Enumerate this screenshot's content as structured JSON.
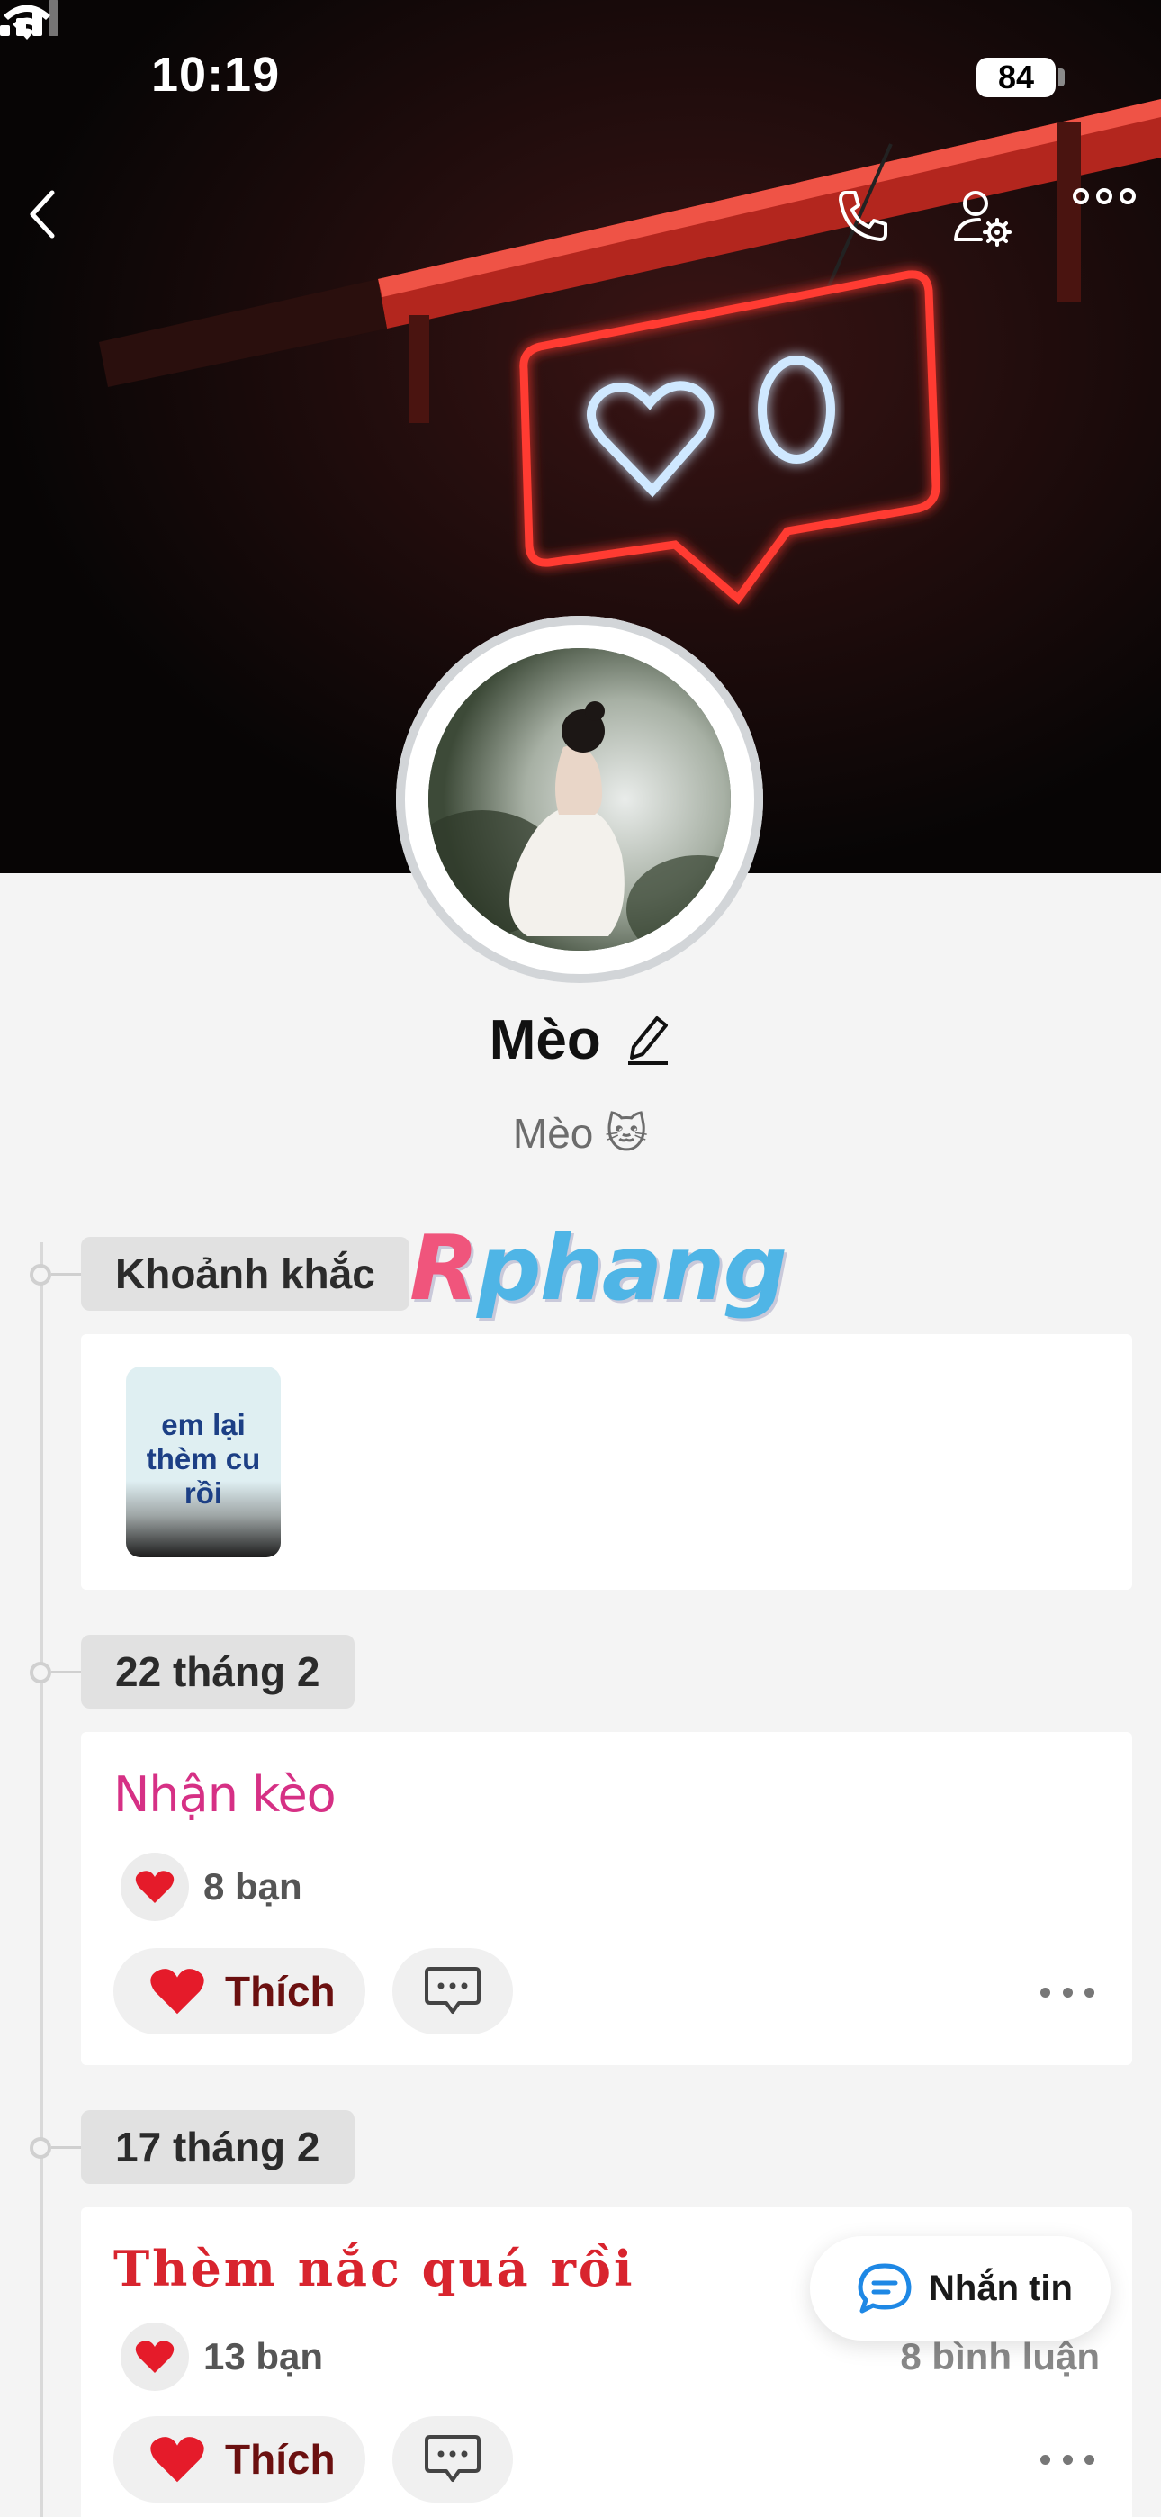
{
  "status_bar": {
    "time": "10:19",
    "battery": "84"
  },
  "profile": {
    "name": "Mèo",
    "bio": "Mèo 🐱"
  },
  "watermark": {
    "r": "R",
    "rest": "phang"
  },
  "moments": {
    "label": "Khoảnh khắc",
    "items": [
      {
        "text_lines": [
          "em lại",
          "thèm cu",
          "rồi"
        ]
      }
    ]
  },
  "posts": [
    {
      "date": "22 tháng 2",
      "title": "Nhận kèo",
      "likes": "8 bạn",
      "comments": "",
      "like_label": "Thích"
    },
    {
      "date": "17 tháng 2",
      "title": "Thèm nắc quá rồi",
      "likes": "13 bạn",
      "comments": "8 bình luận",
      "like_label": "Thích"
    }
  ],
  "message_button": {
    "label": "Nhắn tin"
  },
  "icons": {
    "back": "chevron-left-icon",
    "call": "phone-icon",
    "settings": "user-settings-icon",
    "more": "more-horizontal-icon",
    "edit": "pencil-icon",
    "like": "heart-icon",
    "comment": "comment-icon",
    "message": "chat-bubble-icon"
  },
  "colors": {
    "accent_pink": "#d63085",
    "accent_red": "#d8242e",
    "heart": "#e51b2a",
    "message_blue": "#1e88e5"
  }
}
